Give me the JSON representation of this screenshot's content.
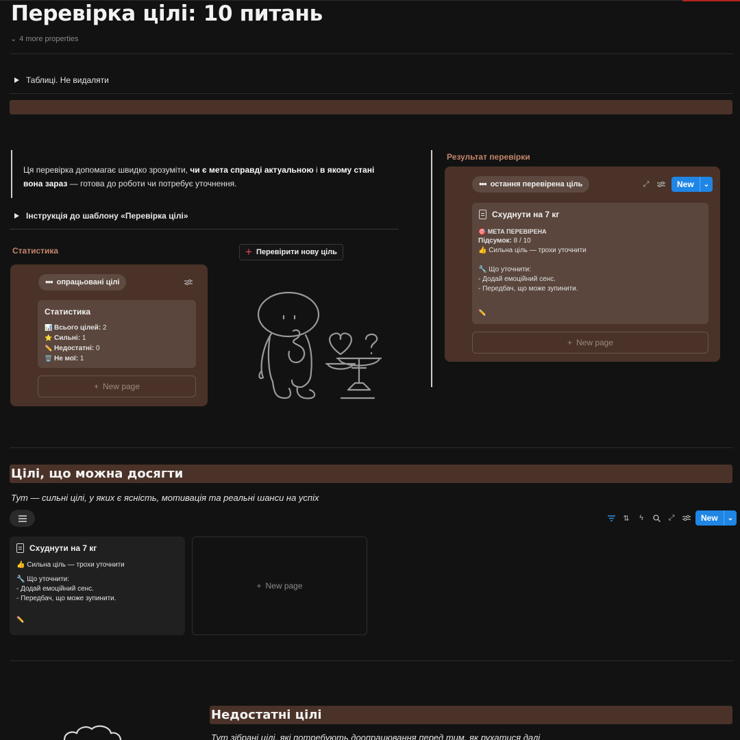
{
  "page": {
    "title": "Перевірка цілі: 10 питань",
    "more_properties": "4 more properties"
  },
  "toggles": {
    "tables": "Таблиці. Не видаляти",
    "instructions": "Інструкція до шаблону «Перевірка цілі»"
  },
  "callout": {
    "part1": "Ця перевірка допомагає швидко зрозуміти, ",
    "bold1": "чи є мета справді актуальною",
    "part2": " і ",
    "bold2": "в якому стані вона зараз",
    "part3": " — готова до роботи чи потребує уточнення."
  },
  "statistics": {
    "label": "Статистика",
    "view_name": "опрацьовані цілі",
    "card_title": "Статистика",
    "lines": [
      {
        "emoji": "📊",
        "label": "Всього цілей:",
        "value": "2"
      },
      {
        "emoji": "⭐",
        "label": "Сильні:",
        "value": "1"
      },
      {
        "emoji": "✏️",
        "label": "Недостатні:",
        "value": "0"
      },
      {
        "emoji": "🗑️",
        "label": "Не мої:",
        "value": "1"
      }
    ],
    "new_page": "New page"
  },
  "check_button": {
    "label": "Перевірити нову ціль"
  },
  "result": {
    "label": "Результат перевірки",
    "view_name": "остання перевірена ціль",
    "new_label": "New",
    "card_title": "Схуднути на 7 кг",
    "status_emoji": "🎯",
    "status": "МЕТА ПЕРЕВІРЕНА",
    "summary_label": "Підсумок:",
    "summary_value": "8 / 10",
    "verdict": "👍 Сильна ціль — трохи уточнити",
    "clarify_title": "🔧 Що уточнити:",
    "clarify_items": [
      "- Додай емоційний сенс.",
      "- Передбач, що може зупинити."
    ],
    "footer_emoji": "✏️",
    "new_page": "New page"
  },
  "achievable": {
    "heading": "Цілі, що можна досягти",
    "description": "Тут — сильні цілі, у яких є ясність, мотивація та реальні шанси на успіх",
    "new_label": "New",
    "card": {
      "title": "Схуднути на 7 кг",
      "verdict": "👍 Сильна ціль — трохи уточнити",
      "clarify_title": "🔧 Що уточнити:",
      "clarify_items": [
        "- Додай емоційний сенс.",
        "- Передбач, що може зупинити."
      ],
      "footer_emoji": "✏️"
    },
    "new_page": "New page"
  },
  "insufficient": {
    "heading": "Недостатні цілі",
    "description": "Тут зібрані цілі, які потребують доопрацювання перед тим, як рухатися далі"
  },
  "colors": {
    "background": "#121212",
    "brown": "#4a3228",
    "accent_blue": "#1f86e6",
    "label_orange": "#c4866a"
  }
}
